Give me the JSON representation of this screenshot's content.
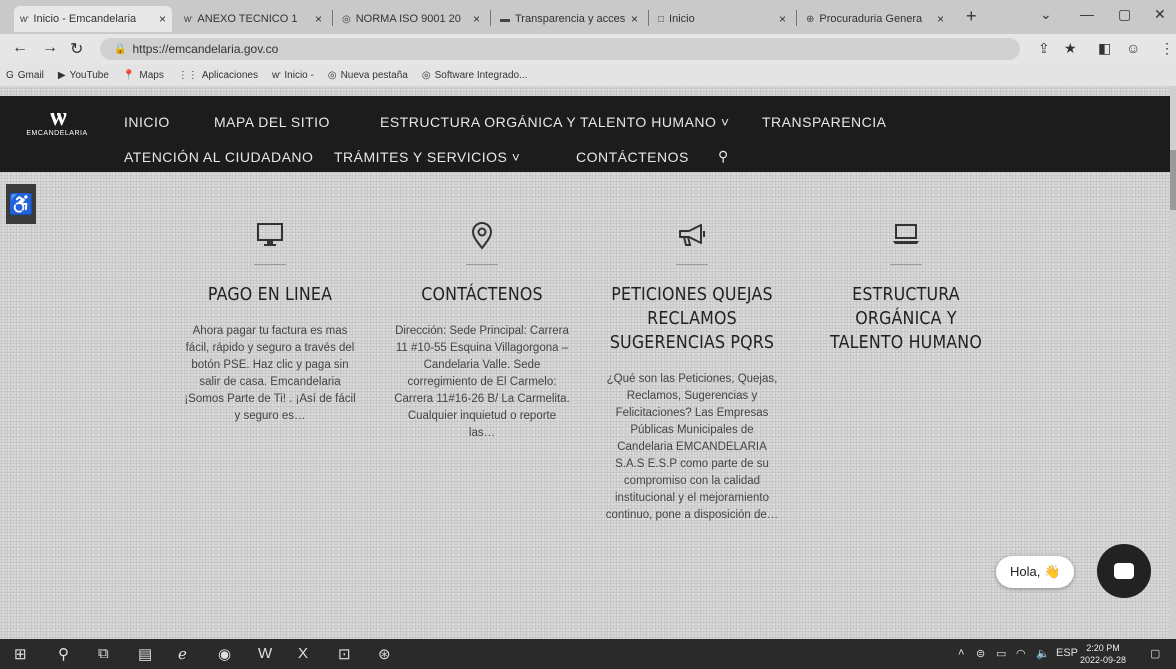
{
  "browser": {
    "tabs": [
      {
        "icon": "site-favicon",
        "title": "Inicio - Emcandelaria",
        "active": true
      },
      {
        "icon": "doc-favicon",
        "title": "ANEXO TECNICO 1",
        "active": false
      },
      {
        "icon": "globe-favicon",
        "title": "NORMA ISO 9001 20",
        "active": false
      },
      {
        "icon": "page-favicon",
        "title": "Transparencia y acces",
        "active": false
      },
      {
        "icon": "blank-favicon",
        "title": "Inicio",
        "active": false
      },
      {
        "icon": "gov-favicon",
        "title": "Procuraduria Genera",
        "active": false
      }
    ],
    "url": "https://emcandelaria.gov.co",
    "bookmarks": [
      {
        "icon": "google-icon",
        "label": "Gmail"
      },
      {
        "icon": "youtube-icon",
        "label": "YouTube"
      },
      {
        "icon": "maps-icon",
        "label": "Maps"
      },
      {
        "icon": "apps-icon",
        "label": "Aplicaciones"
      },
      {
        "icon": "site-favicon",
        "label": "Inicio -"
      },
      {
        "icon": "globe-icon",
        "label": "Nueva pestaña"
      },
      {
        "icon": "globe-icon",
        "label": "Software Integrado..."
      }
    ]
  },
  "site": {
    "logo_text": "EMCANDELARIA",
    "nav": {
      "inicio": "INICIO",
      "mapa": "MAPA DEL SITIO",
      "estructura": "ESTRUCTURA ORGÁNICA Y TALENTO HUMANO ˅",
      "transparencia": "TRANSPARENCIA",
      "atencion": "ATENCIÓN AL CIUDADANO",
      "tramites": "TRÁMITES Y SERVICIOS ˅",
      "contactenos": "CONTÁCTENOS"
    },
    "features": [
      {
        "icon": "monitor-icon",
        "title": "PAGO EN LINEA",
        "text": "Ahora pagar tu factura es mas fácil, rápido y seguro a través del botón PSE. Haz clic y paga sin salir de casa. Emcandelaria ¡Somos Parte de Ti! . ¡Así de fácil y seguro es…"
      },
      {
        "icon": "map-pin-icon",
        "title": "CONTÁCTENOS",
        "text": "Dirección: Sede Principal: Carrera 11 #10-55 Esquina Villagorgona – Candelaria Valle. Sede corregimiento de El Carmelo: Carrera 11#16-26 B/ La Carmelita. Cualquier inquietud o reporte las…"
      },
      {
        "icon": "megaphone-icon",
        "title": "PETICIONES QUEJAS RECLAMOS SUGERENCIAS PQRS",
        "text": "¿Qué son las Peticiones, Quejas, Reclamos, Sugerencias y Felicitaciones? Las Empresas Públicas Municipales de Candelaria EMCANDELARIA S.A.S E.S.P como parte de su compromiso con la calidad institucional y el mejoramiento continuo, pone a disposición de…"
      },
      {
        "icon": "laptop-icon",
        "title": "ESTRUCTURA ORGÁNICA Y TALENTO HUMANO",
        "text": ""
      }
    ],
    "chat": {
      "greeting": "Hola, 👋"
    }
  },
  "taskbar": {
    "time": "2:20 PM",
    "date": "2022-09-28",
    "language": "ESP"
  }
}
